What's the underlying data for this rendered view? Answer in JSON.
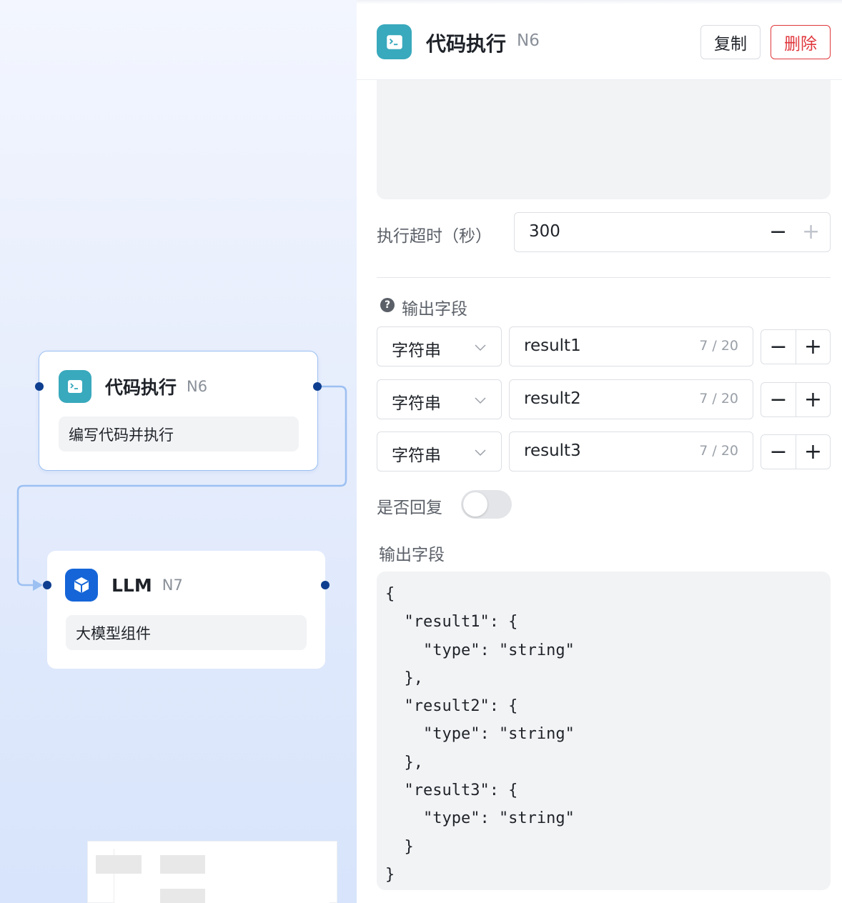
{
  "canvas": {
    "nodes": [
      {
        "title": "代码执行",
        "id": "N6",
        "desc": "编写代码并执行",
        "icon": "terminal-icon",
        "color": "#39a9bd",
        "selected": true
      },
      {
        "title": "LLM",
        "id": "N7",
        "desc": "大模型组件",
        "icon": "cube-icon",
        "color": "#1565d8",
        "selected": false
      }
    ]
  },
  "panel": {
    "header": {
      "icon": "terminal-icon",
      "title": "代码执行",
      "id": "N6",
      "copy_label": "复制",
      "delete_label": "删除"
    },
    "timeout": {
      "label": "执行超时（秒）",
      "value": "300",
      "minus": "−",
      "plus": "+"
    },
    "outputs": {
      "label": "输出字段",
      "rows": [
        {
          "type": "字符串",
          "name": "result1",
          "count": "7 / 20"
        },
        {
          "type": "字符串",
          "name": "result2",
          "count": "7 / 20"
        },
        {
          "type": "字符串",
          "name": "result3",
          "count": "7 / 20"
        }
      ],
      "minus": "−",
      "plus": "+"
    },
    "reply": {
      "label": "是否回复",
      "enabled": false
    },
    "schema": {
      "label": "输出字段",
      "json": "{\n  \"result1\": {\n    \"type\": \"string\"\n  },\n  \"result2\": {\n    \"type\": \"string\"\n  },\n  \"result3\": {\n    \"type\": \"string\"\n  }\n}"
    }
  },
  "colors": {
    "accent": "#0e3e8f",
    "danger": "#e0373d",
    "code_node": "#39a9bd",
    "llm_node": "#1565d8"
  }
}
